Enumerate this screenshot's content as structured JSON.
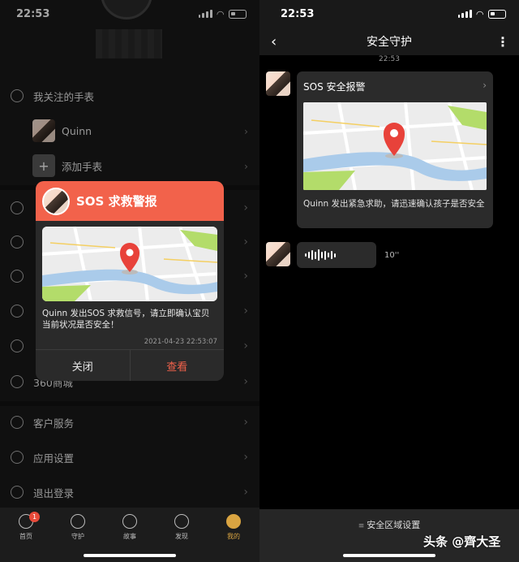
{
  "left": {
    "status": {
      "time": "22:53"
    },
    "menu": {
      "watch_header": "我关注的手表",
      "watch_name": "Quinn",
      "add_watch": "添加手表",
      "mall": "360商城",
      "customer_service": "客户服务",
      "app_settings": "应用设置",
      "logout": "退出登录"
    },
    "dialog": {
      "title": "SOS 求救警报",
      "message": "Quinn 发出SOS 求救信号，请立即确认宝贝当前状况是否安全！",
      "timestamp": "2021-04-23 22:53:07",
      "close_label": "关闭",
      "view_label": "查看"
    },
    "tabs": [
      {
        "label": "首页",
        "badge": "1"
      },
      {
        "label": "守护"
      },
      {
        "label": "故事"
      },
      {
        "label": "发现"
      },
      {
        "label": "我的"
      }
    ]
  },
  "right": {
    "status": {
      "time": "22:53"
    },
    "nav_title": "安全守护",
    "chat_time": "22:53",
    "card": {
      "title": "SOS 安全报警",
      "text": "Quinn 发出紧急求助，请迅速确认孩子是否安全"
    },
    "voice_duration": "10''",
    "safe_zone_label": "安全区域设置"
  },
  "watermark": "头条 @齊大圣",
  "colors": {
    "alert_red": "#f2624b",
    "active_gold": "#d9a441",
    "pin_red": "#e8423a"
  }
}
